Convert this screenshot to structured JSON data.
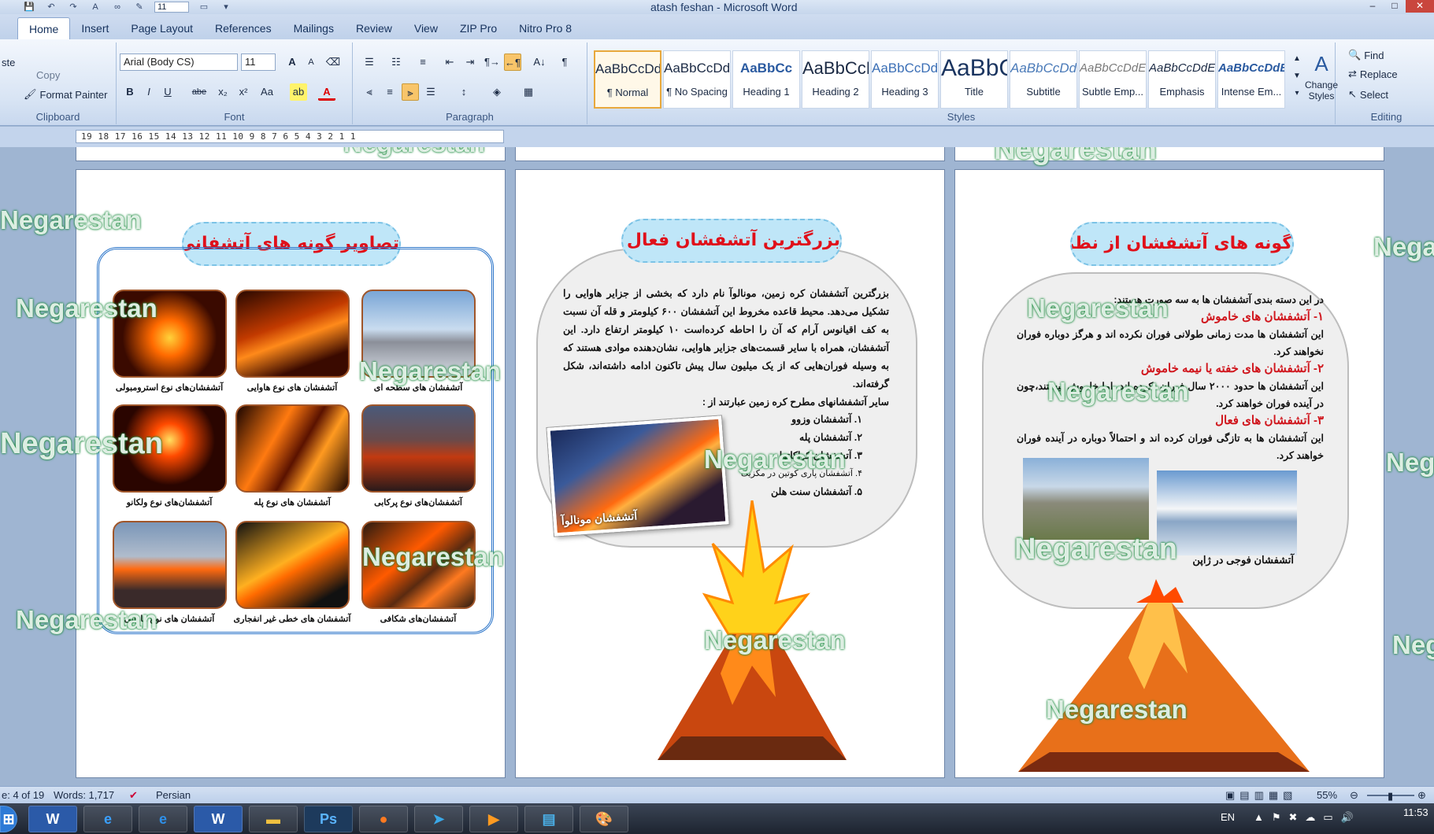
{
  "window": {
    "title": "atash feshan - Microsoft Word",
    "min": "–",
    "max": "□",
    "close": "✕"
  },
  "qat": {
    "font_size_box": "11"
  },
  "tabs": [
    "Home",
    "Insert",
    "Page Layout",
    "References",
    "Mailings",
    "Review",
    "View",
    "ZIP Pro",
    "Nitro Pro 8"
  ],
  "ribbon": {
    "clipboard": {
      "label": "Clipboard",
      "copy": "Copy",
      "paste": "ste",
      "format_painter": "Format Painter"
    },
    "font": {
      "label": "Font",
      "font_name": "Arial (Body CS)",
      "font_size": "11",
      "grow": "A",
      "shrink": "A",
      "clear": "⌫",
      "bold": "B",
      "italic": "I",
      "underline": "U",
      "strike": "abe",
      "subscript": "x₂",
      "superscript": "x²",
      "case": "Aa",
      "highlight": "ab",
      "color": "A"
    },
    "paragraph": {
      "label": "Paragraph",
      "pilcrow": "¶",
      "sort": "A↓"
    },
    "styles": {
      "label": "Styles",
      "items": [
        {
          "sample": "AaBbCcDdEe",
          "name": "¶ Normal"
        },
        {
          "sample": "AaBbCcDdEe",
          "name": "¶ No Spacing"
        },
        {
          "sample": "AaBbCc",
          "name": "Heading 1"
        },
        {
          "sample": "AaBbCcDdEe",
          "name": "Heading 2"
        },
        {
          "sample": "AaBbCcDdEe",
          "name": "Heading 3"
        },
        {
          "sample": "AaBbCcDdEe",
          "name": "Title"
        },
        {
          "sample": "AaBbCcDdEe",
          "name": "Subtitle"
        },
        {
          "sample": "AaBbCcDdEe",
          "name": "Subtle Emp..."
        },
        {
          "sample": "AaBbCcDdEe",
          "name": "Emphasis"
        },
        {
          "sample": "AaBbCcDdEe",
          "name": "Intense Em..."
        }
      ],
      "change_styles": "Change Styles"
    },
    "editing": {
      "label": "Editing",
      "find": "Find",
      "replace": "Replace",
      "select": "Select"
    }
  },
  "ruler": "19 18 17 16 15 14 13 12 11 10 9 8 7 6 5 4 3 2 1   1",
  "pages": {
    "left": {
      "title": "تصاویر گونه های آتشفانی از نظر فوران",
      "captions": [
        "آتشفشان های سطحه ای",
        "آتشفشان های نوع هاوایی",
        "آتشفشان‌های نوع استرومبولی",
        "آتشفشان‌های نوع پرکابی",
        "آتشفشان های نوع پله",
        "آتشفشان‌های نوع ولکانو",
        "آتشفشان‌های شکافی",
        "آتشفشان های خطی غیر انفجاری",
        "آتشفشان های نوع هاوایی"
      ]
    },
    "middle": {
      "title": "بزرگترین آتشفشان فعال جهان",
      "paragraph": "بزرگترین آتشفشان کره زمین، مونالوآ نام دارد که بخشی از جزایر هاوایی را تشکیل می‌دهد. محیط قاعده مخروط این آتشفشان ۶۰۰ کیلومتر و قله آن نسبت به کف اقیانوس آرام که آن را احاطه کرده‌است ۱۰ کیلومتر ارتفاع دارد. این آتشفشان، همراه با سایر قسمت‌های جزایر هاوایی، نشان‌دهنده موادی هستند که به وسیله فوران‌هایی که از یک میلیون سال پیش تاکنون ادامه داشته‌اند، شکل گرفته‌اند.",
      "intro": "سایر آتشفشانهای مطرح کره زمین عبارتند از :",
      "list": [
        "۱. آتشفشان وزوو",
        "۲. آتشفشان پله",
        "۳. آتشفشان کراکاتوا",
        "۴. آتشفشان پاری کوتین در مکزیک",
        "۵. آتشفشان سنت هلن"
      ],
      "photo_caption": "آتشفشان مونالوآ"
    },
    "right": {
      "title": "گونه های آتشفشان از نظر انرژی درونی",
      "intro": "در این دسته بندی آتشفشان ها به سه صورت هستند:",
      "h1": "۱- آتشفشان های خاموش",
      "p1": "این آتشفشان ها مدت زمانی طولانی فوران نکرده اند و هرگز دوباره فوران نخواهند کرد.",
      "h2": "۲- آتشفشان های خفته یا نیمه خاموش",
      "p2": "این آتشفشان ها حدود ۲۰۰۰ سال فوران نکرده اند، اما خاموش نیستند،چون در آینده فوران خواهند کرد.",
      "h3": "۳- آتشفشان های فعال",
      "p3": "این آتشفشان ها به تازگی فوران کرده اند و احتمالاً دوباره در آینده فوران خواهند کرد.",
      "photo_caption": "آتشفشان فوجی در ژاپن"
    }
  },
  "watermark": "Negarestan",
  "status": {
    "page": "e: 4 of 19",
    "words": "Words: 1,717",
    "language": "Persian",
    "zoom": "55%"
  },
  "taskbar": {
    "lang": "EN",
    "time": "11:53"
  }
}
